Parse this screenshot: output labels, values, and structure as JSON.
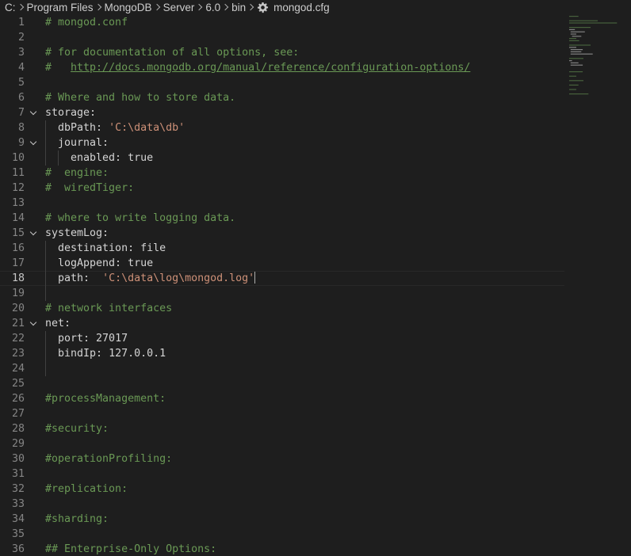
{
  "breadcrumb": {
    "items": [
      "C:",
      "Program Files",
      "MongoDB",
      "Server",
      "6.0",
      "bin"
    ],
    "file": "mongod.cfg",
    "file_icon": "gear-icon"
  },
  "editor": {
    "current_line": 18,
    "lines": [
      {
        "n": "1",
        "text": "# mongod.conf"
      },
      {
        "n": "2",
        "text": ""
      },
      {
        "n": "3",
        "text": "# for documentation of all options, see:"
      },
      {
        "n": "4",
        "text": "#   ",
        "link": "http://docs.mongodb.org/manual/reference/configuration-options/"
      },
      {
        "n": "5",
        "text": ""
      },
      {
        "n": "6",
        "text": "# Where and how to store data."
      },
      {
        "n": "7",
        "key": "storage:"
      },
      {
        "n": "8",
        "key": "  dbPath: ",
        "str": "'C:\\data\\db'"
      },
      {
        "n": "9",
        "key": "  journal:"
      },
      {
        "n": "10",
        "key": "    enabled: ",
        "val": "true"
      },
      {
        "n": "11",
        "text": "#  engine:"
      },
      {
        "n": "12",
        "text": "#  wiredTiger:"
      },
      {
        "n": "13",
        "text": ""
      },
      {
        "n": "14",
        "text": "# where to write logging data."
      },
      {
        "n": "15",
        "key": "systemLog:"
      },
      {
        "n": "16",
        "key": "  destination: ",
        "val": "file"
      },
      {
        "n": "17",
        "key": "  logAppend: ",
        "val": "true"
      },
      {
        "n": "18",
        "key": "  path:  ",
        "str": "'C:\\data\\log\\mongod.log'"
      },
      {
        "n": "19",
        "text": ""
      },
      {
        "n": "20",
        "text": "# network interfaces"
      },
      {
        "n": "21",
        "key": "net:"
      },
      {
        "n": "22",
        "key": "  port: ",
        "val": "27017"
      },
      {
        "n": "23",
        "key": "  bindIp: ",
        "val": "127.0.0.1"
      },
      {
        "n": "24",
        "text": ""
      },
      {
        "n": "25",
        "text": ""
      },
      {
        "n": "26",
        "text": "#processManagement:"
      },
      {
        "n": "27",
        "text": ""
      },
      {
        "n": "28",
        "text": "#security:"
      },
      {
        "n": "29",
        "text": ""
      },
      {
        "n": "30",
        "text": "#operationProfiling:"
      },
      {
        "n": "31",
        "text": ""
      },
      {
        "n": "32",
        "text": "#replication:"
      },
      {
        "n": "33",
        "text": ""
      },
      {
        "n": "34",
        "text": "#sharding:"
      },
      {
        "n": "35",
        "text": ""
      },
      {
        "n": "36",
        "text": "## Enterprise-Only Options:"
      }
    ]
  },
  "colors": {
    "background": "#1e1e1e",
    "comment": "#6a9955",
    "string": "#ce9178",
    "text": "#d4d4d4",
    "line_number": "#858585",
    "gear": "#c5c5c5"
  }
}
